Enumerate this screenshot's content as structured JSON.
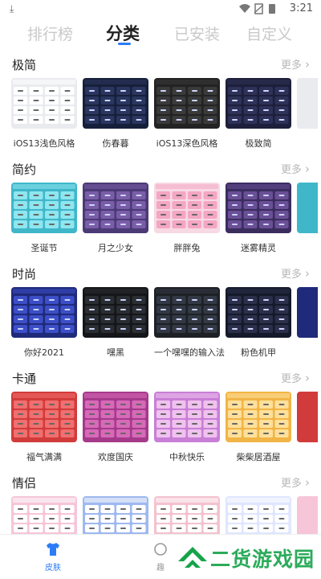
{
  "status_bar": {
    "time": "3:21"
  },
  "tabs": [
    {
      "label": "排行榜"
    },
    {
      "label": "分类"
    },
    {
      "label": "已安装"
    },
    {
      "label": "自定义"
    }
  ],
  "active_tab": "分类",
  "sections": [
    {
      "title": "极简",
      "more": "更多",
      "items": [
        {
          "name": "iOS13浅色风格",
          "theme": "light",
          "bg": "#e9ebef",
          "key": "#ffffff"
        },
        {
          "name": "伤春暮",
          "theme": "dark",
          "bg": "#17203a",
          "key": "#2a3660"
        },
        {
          "name": "iOS13深色风格",
          "theme": "dark",
          "bg": "#232323",
          "key": "#3a3a3a"
        },
        {
          "name": "极致简",
          "theme": "dark",
          "bg": "#1d1f3b",
          "key": "#2e3258"
        }
      ]
    },
    {
      "title": "简约",
      "more": "更多",
      "items": [
        {
          "name": "圣诞节",
          "theme": "light",
          "bg": "#3fb7c9",
          "key": "#8fe6ef"
        },
        {
          "name": "月之少女",
          "theme": "dark",
          "bg": "#4b3a76",
          "key": "#7a5da8"
        },
        {
          "name": "胖胖兔",
          "theme": "light",
          "bg": "#f7d9e3",
          "key": "#f4a6c3"
        },
        {
          "name": "迷雾精灵",
          "theme": "dark",
          "bg": "#3a2d5e",
          "key": "#6a4f97"
        }
      ]
    },
    {
      "title": "时尚",
      "more": "更多",
      "items": [
        {
          "name": "你好2021",
          "theme": "dark",
          "bg": "#202a7a",
          "key": "#3c4fc7"
        },
        {
          "name": "嘿黑",
          "theme": "dark",
          "bg": "#141619",
          "key": "#2a2d31"
        },
        {
          "name": "一个嘿嘿的输入法",
          "theme": "dark",
          "bg": "#1d2126",
          "key": "#333944"
        },
        {
          "name": "粉色机甲",
          "theme": "dark",
          "bg": "#151a2b",
          "key": "#2b2f4a"
        }
      ]
    },
    {
      "title": "卡通",
      "more": "更多",
      "items": [
        {
          "name": "福气满满",
          "theme": "light",
          "bg": "#d23b3b",
          "key": "#f06f6f"
        },
        {
          "name": "欢度国庆",
          "theme": "light",
          "bg": "#a63a8a",
          "key": "#d76ab8"
        },
        {
          "name": "中秋快乐",
          "theme": "light",
          "bg": "#c87fd6",
          "key": "#f0c2ee"
        },
        {
          "name": "柴柴居酒屋",
          "theme": "light",
          "bg": "#f1b547",
          "key": "#ffe09b"
        }
      ]
    },
    {
      "title": "情侣",
      "more": "更多",
      "items": [
        {
          "name": "",
          "theme": "light",
          "bg": "#f6c6d8",
          "key": "#ffffff"
        },
        {
          "name": "",
          "theme": "light",
          "bg": "#9fb9f0",
          "key": "#ffffff"
        },
        {
          "name": "",
          "theme": "light",
          "bg": "#f3c2cf",
          "key": "#ffffff"
        },
        {
          "name": "",
          "theme": "light",
          "bg": "#dfe6ff",
          "key": "#ffffff"
        }
      ]
    }
  ],
  "bottom_nav": [
    {
      "label": "皮肤"
    },
    {
      "label": "趣"
    }
  ],
  "watermark": {
    "text": "二货游戏园"
  },
  "colors": {
    "accent": "#2b7cf6"
  }
}
